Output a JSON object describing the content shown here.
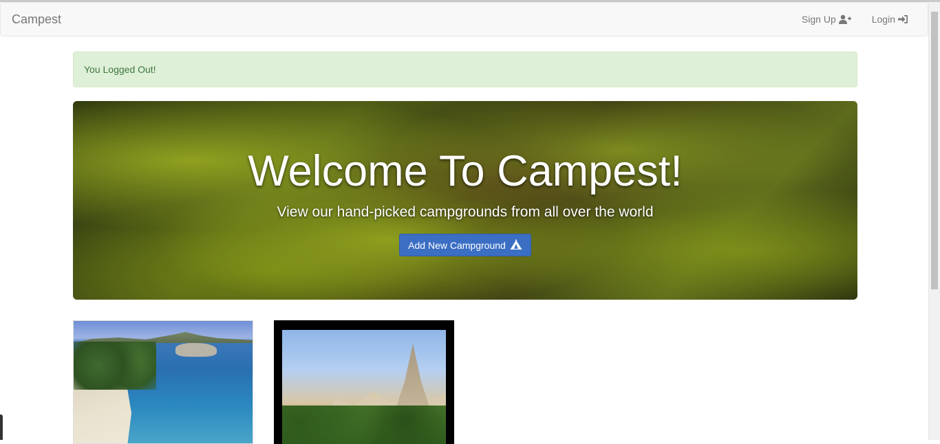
{
  "navbar": {
    "brand": "Campest",
    "signup_label": "Sign Up",
    "login_label": "Login"
  },
  "alert": {
    "message": "You Logged Out!"
  },
  "jumbotron": {
    "title": "Welcome To Campest!",
    "subtitle": "View our hand-picked campgrounds from all over the world",
    "button_label": "Add New Campground"
  },
  "icons": {
    "signup": "user-plus-icon",
    "login": "sign-in-icon",
    "campground": "tent-icon"
  },
  "colors": {
    "alert_bg": "#dff0d8",
    "alert_text": "#3c763d",
    "primary_button": "#3b6fc4",
    "navbar_bg": "#f8f8f8"
  }
}
